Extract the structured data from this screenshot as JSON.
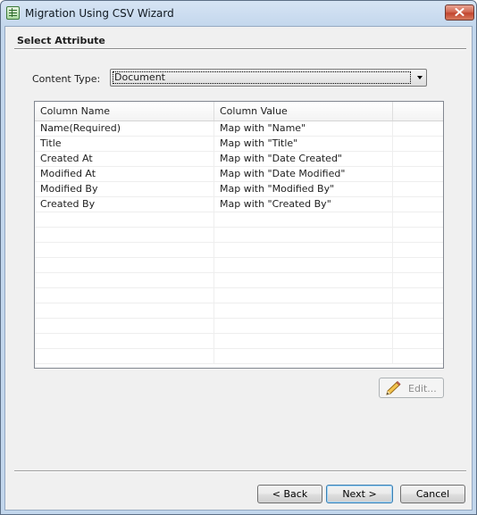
{
  "window": {
    "title": "Migration Using CSV Wizard"
  },
  "section": {
    "title": "Select Attribute"
  },
  "content_type": {
    "label": "Content Type:",
    "value": "Document"
  },
  "grid": {
    "columns": [
      "Column Name",
      "Column Value",
      ""
    ],
    "rows": [
      {
        "name": "Name(Required)",
        "value": "Map with \"Name\""
      },
      {
        "name": "Title",
        "value": "Map with \"Title\""
      },
      {
        "name": "Created At",
        "value": "Map with \"Date Created\""
      },
      {
        "name": "Modified At",
        "value": "Map with \"Date Modified\""
      },
      {
        "name": "Modified By",
        "value": "Map with \"Modified By\""
      },
      {
        "name": "Created By",
        "value": "Map with \"Created By\""
      }
    ],
    "empty_row_count": 10
  },
  "buttons": {
    "edit": "Edit...",
    "back": "< Back",
    "next": "Next >",
    "cancel": "Cancel"
  },
  "icons": {
    "app": "csv-wizard-icon",
    "close": "close-icon",
    "dropdown": "chevron-down-icon",
    "edit": "pencil-icon"
  },
  "colors": {
    "title_bar": "#c2d6ec",
    "close_button": "#c24630",
    "default_button_border": "#3c7fb1"
  }
}
